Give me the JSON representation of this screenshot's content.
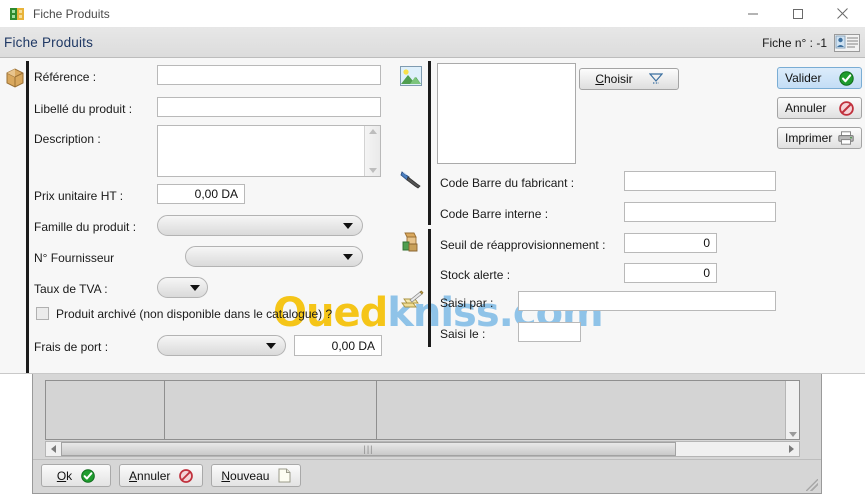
{
  "window": {
    "title": "Fiche Produits",
    "icon": "app-icon",
    "controls": {
      "minimize": "minimize-icon",
      "maximize": "maximize-icon",
      "close": "close-icon"
    }
  },
  "header": {
    "title": "Fiche Produits",
    "record_label": "Fiche  n° : -1",
    "card_icon": "contact-card-icon"
  },
  "left_panel": {
    "icon": "package-icon",
    "fields": {
      "reference": {
        "label": "Référence :",
        "value": ""
      },
      "libelle": {
        "label": "Libellé du produit :",
        "value": ""
      },
      "description": {
        "label": "Description :",
        "value": ""
      },
      "prix": {
        "label": "Prix unitaire HT :",
        "value": "0,00 DA"
      },
      "famille": {
        "label": "Famille du produit :",
        "value": ""
      },
      "fournisseur": {
        "label": "N° Fournisseur",
        "value": ""
      },
      "tva": {
        "label": "Taux de TVA :",
        "value": ""
      },
      "archive": {
        "label": "Produit archivé (non disponible dans le catalogue) ?",
        "checked": false
      },
      "frais_port": {
        "label": "Frais de port :",
        "select_value": "",
        "amount": "0,00 DA"
      }
    }
  },
  "image_panel": {
    "icon": "picture-icon",
    "choose_button": {
      "label": "Choisir",
      "mnemonic": "C",
      "dropdown_icon": "dropdown-triangle-icon"
    }
  },
  "right_panel": {
    "barcode_icon": "barcode-scanner-icon",
    "stock_icon": "boxes-icon",
    "entry_icon": "notepad-pen-icon",
    "fields": {
      "code_fabricant": {
        "label": "Code Barre du fabricant :",
        "value": ""
      },
      "code_interne": {
        "label": "Code Barre interne :",
        "value": ""
      },
      "seuil": {
        "label": "Seuil de réapprovisionnement :",
        "value": "0"
      },
      "stock_alerte": {
        "label": "Stock alerte :",
        "value": "0"
      },
      "saisi_par": {
        "label": "Saisi par :",
        "value": ""
      },
      "saisi_le": {
        "label": "Saisi le :",
        "value": ""
      }
    }
  },
  "actions": [
    {
      "label": "Valider",
      "icon": "check-circle-icon",
      "selected": true
    },
    {
      "label": "Annuler",
      "icon": "no-entry-icon",
      "selected": false
    },
    {
      "label": "Imprimer",
      "icon": "printer-icon",
      "selected": false
    }
  ],
  "footer_buttons": [
    {
      "label": "Ok",
      "mnemonic": "O",
      "rest": "k",
      "icon": "check-circle-icon"
    },
    {
      "label": "Annuler",
      "mnemonic": "A",
      "rest": "nnuler",
      "icon": "no-entry-icon"
    },
    {
      "label": "Nouveau",
      "mnemonic": "N",
      "rest": "ouveau",
      "icon": "new-document-icon"
    }
  ],
  "background_window": {
    "hscroll_thumb_glyph": "|||",
    "left_arrow_icon": "scroll-left-icon",
    "right_arrow_icon": "scroll-right-icon",
    "down_arrow_icon": "scroll-down-icon",
    "resize_grip_icon": "resize-grip-icon"
  },
  "watermark": {
    "part1": "Oued",
    "part2": "kniss.com",
    "color1": "#f5c518",
    "color2": "#8fc3e8"
  }
}
